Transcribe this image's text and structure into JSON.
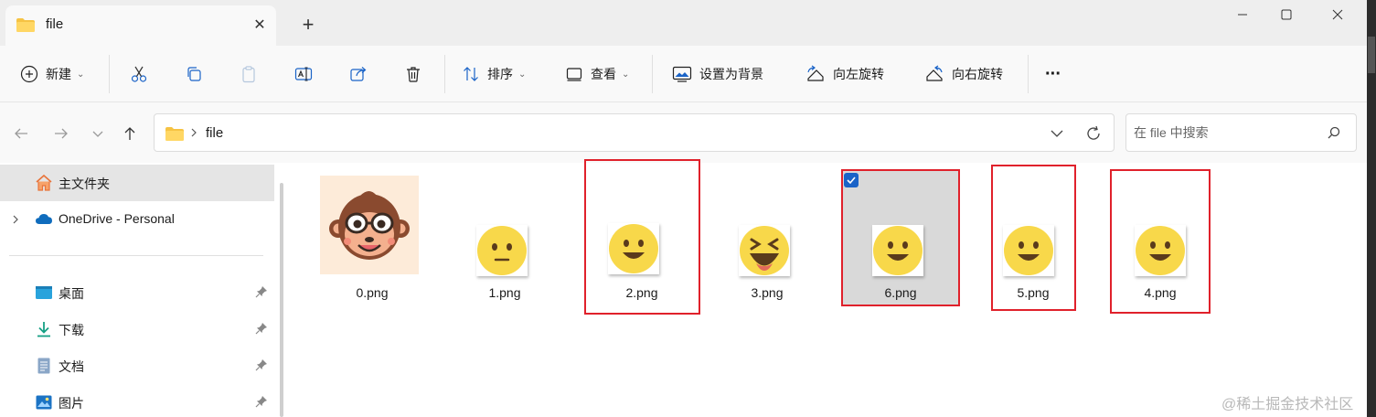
{
  "tab": {
    "title": "file",
    "close": "✕"
  },
  "newtab": "+",
  "window_controls": {
    "minimize": "—",
    "maximize": "☐",
    "close": "✕"
  },
  "toolbar": {
    "new_label": "新建",
    "sort_label": "排序",
    "view_label": "查看",
    "set_background_label": "设置为背景",
    "rotate_left_label": "向左旋转",
    "rotate_right_label": "向右旋转",
    "more_label": "···"
  },
  "nav": {
    "back": "←",
    "forward": "→",
    "recent": "⌄",
    "up": "↑"
  },
  "address": {
    "crumb": "file"
  },
  "search": {
    "placeholder": "在 file 中搜索"
  },
  "sidebar": {
    "items": [
      {
        "label": "主文件夹",
        "icon": "home-icon"
      },
      {
        "label": "OneDrive - Personal",
        "icon": "onedrive-cloud-icon"
      },
      {
        "label": "桌面",
        "icon": "desktop-icon"
      },
      {
        "label": "下载",
        "icon": "download-icon"
      },
      {
        "label": "文档",
        "icon": "document-icon"
      },
      {
        "label": "图片",
        "icon": "pictures-icon"
      }
    ]
  },
  "files": [
    {
      "name": "0.png",
      "kind": "monkey"
    },
    {
      "name": "1.png",
      "kind": "neutral"
    },
    {
      "name": "2.png",
      "kind": "smile"
    },
    {
      "name": "3.png",
      "kind": "laugh"
    },
    {
      "name": "6.png",
      "kind": "smile",
      "selected": true
    },
    {
      "name": "5.png",
      "kind": "smile"
    },
    {
      "name": "4.png",
      "kind": "smile"
    }
  ],
  "watermark": "@稀土掘金技术社区",
  "colors": {
    "accent": "#1a63c7",
    "highlight_box": "#e0212b",
    "emoji": "#f8d84a",
    "folder": "#f6c343"
  }
}
